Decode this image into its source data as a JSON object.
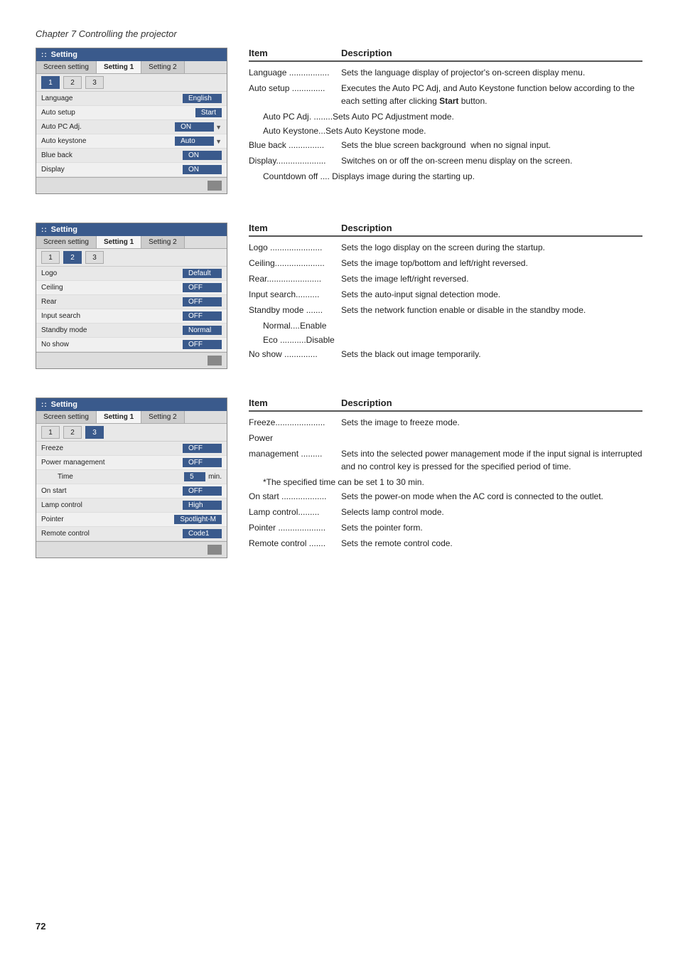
{
  "chapter": "Chapter 7 Controlling the projector",
  "page_number": "72",
  "sections": [
    {
      "id": "section1",
      "ui": {
        "title": "Setting",
        "tabs": [
          "Screen setting",
          "Setting 1",
          "Setting 2"
        ],
        "active_tab": "Setting 1",
        "active_tab_index": 0,
        "numbers": [
          "1",
          "2",
          "3"
        ],
        "active_number": "1",
        "rows": [
          {
            "label": "Language",
            "value": "English",
            "type": "value-box"
          },
          {
            "label": "Auto setup",
            "value": "Start",
            "type": "button"
          },
          {
            "label": "Auto PC Adj.",
            "value": "ON",
            "type": "select"
          },
          {
            "label": "Auto keystone",
            "value": "Auto",
            "type": "select"
          },
          {
            "label": "Blue back",
            "value": "ON",
            "type": "value-box"
          },
          {
            "label": "Display",
            "value": "ON",
            "type": "value-box"
          }
        ]
      },
      "table": {
        "col_item": "Item",
        "col_desc": "Description",
        "rows": [
          {
            "item": "Language .................",
            "desc": "Sets the language display of projector's on-screen display menu.",
            "sub": false
          },
          {
            "item": "Auto setup ..............",
            "desc": "Executes the Auto PC Adj, and Auto Keystone function below according to the each setting after clicking ",
            "bold_end": "Start",
            "desc_end": " button.",
            "sub": false
          },
          {
            "item": "",
            "desc": "Auto PC Adj. ........Sets Auto PC Adjustment mode.",
            "sub": true
          },
          {
            "item": "",
            "desc": "Auto Keystone...Sets Auto Keystone mode.",
            "sub": true
          },
          {
            "item": "Blue back ...............",
            "desc": "Sets the blue screen background  when no signal input.",
            "sub": false
          },
          {
            "item": "Display.....................",
            "desc": "Switches on or off the on-screen menu display on the screen.",
            "sub": false
          },
          {
            "item": "",
            "desc": "Countdown off .... Displays image during the starting up.",
            "sub": true
          }
        ]
      }
    },
    {
      "id": "section2",
      "ui": {
        "title": "Setting",
        "tabs": [
          "Screen setting",
          "Setting 1",
          "Setting 2"
        ],
        "active_tab": "Setting 1",
        "active_tab_index": 0,
        "numbers": [
          "1",
          "2",
          "3"
        ],
        "active_number": "2",
        "rows": [
          {
            "label": "Logo",
            "value": "Default",
            "type": "value-box"
          },
          {
            "label": "Ceiling",
            "value": "OFF",
            "type": "value-box"
          },
          {
            "label": "Rear",
            "value": "OFF",
            "type": "value-box"
          },
          {
            "label": "Input search",
            "value": "OFF",
            "type": "value-box"
          },
          {
            "label": "Standby mode",
            "value": "Normal",
            "type": "value-box"
          },
          {
            "label": "No show",
            "value": "OFF",
            "type": "value-box"
          }
        ]
      },
      "table": {
        "col_item": "Item",
        "col_desc": "Description",
        "rows": [
          {
            "item": "Logo ......................",
            "desc": "Sets the logo display on the screen during the startup.",
            "sub": false
          },
          {
            "item": "Ceiling...................",
            "desc": "Sets the image top/bottom and left/right reversed.",
            "sub": false
          },
          {
            "item": "Rear.......................",
            "desc": "Sets the image left/right reversed.",
            "sub": false
          },
          {
            "item": "Input search..........",
            "desc": "Sets the auto-input signal detection mode.",
            "sub": false
          },
          {
            "item": "Standby mode .......",
            "desc": "Sets the network function enable or disable in the standby mode.",
            "sub": false
          },
          {
            "item": "",
            "desc": "Normal....Enable",
            "sub": true
          },
          {
            "item": "",
            "desc": "Eco ...........Disable",
            "sub": true
          },
          {
            "item": "No show ..............",
            "desc": "Sets the black out image temporarily.",
            "sub": false
          }
        ]
      }
    },
    {
      "id": "section3",
      "ui": {
        "title": "Setting",
        "tabs": [
          "Screen setting",
          "Setting 1",
          "Setting 2"
        ],
        "active_tab": "Setting 1",
        "active_tab_index": 0,
        "numbers": [
          "1",
          "2",
          "3"
        ],
        "active_number": "3",
        "rows": [
          {
            "label": "Freeze",
            "value": "OFF",
            "type": "value-box"
          },
          {
            "label": "Power management",
            "value": "OFF",
            "type": "value-box"
          },
          {
            "label": "",
            "value": "5",
            "extra": "min.",
            "type": "time-row"
          },
          {
            "label": "On start",
            "value": "OFF",
            "type": "value-box"
          },
          {
            "label": "Lamp control",
            "value": "High",
            "type": "value-box"
          },
          {
            "label": "Pointer",
            "value": "Spotlight-M",
            "type": "value-box"
          },
          {
            "label": "Remote control",
            "value": "Code1",
            "type": "value-box"
          }
        ]
      },
      "table": {
        "col_item": "Item",
        "col_desc": "Description",
        "rows": [
          {
            "item": "Freeze.....................",
            "desc": "Sets the image to freeze mode.",
            "sub": false
          },
          {
            "item": "Power",
            "desc": "",
            "sub": false
          },
          {
            "item": "management .........",
            "desc": "Sets into the selected power management mode if the input signal is interrupted and no control key is pressed for the specified period of time.",
            "sub": false
          },
          {
            "item": "",
            "desc": "*The specified time can be set 1 to 30 min.",
            "sub": true
          },
          {
            "item": "On start ...................",
            "desc": "Sets the power-on mode when the AC cord  is connected to the outlet.",
            "sub": false
          },
          {
            "item": "Lamp control.........",
            "desc": "Selects lamp control mode.",
            "sub": false
          },
          {
            "item": "Pointer ....................",
            "desc": "Sets the pointer form.",
            "sub": false
          },
          {
            "item": "Remote control .......",
            "desc": "Sets the remote control code.",
            "sub": false
          }
        ]
      }
    }
  ]
}
